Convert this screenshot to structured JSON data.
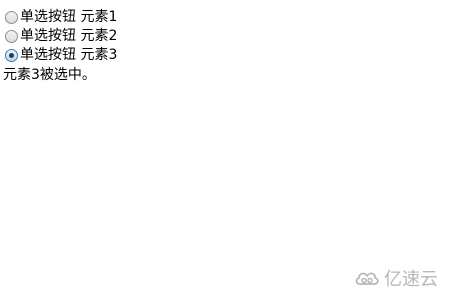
{
  "radios": [
    {
      "label": "单选按钮 元素1",
      "checked": false
    },
    {
      "label": "单选按钮 元素2",
      "checked": false
    },
    {
      "label": "单选按钮 元素3",
      "checked": true
    }
  ],
  "status_text": "元素3被选中。",
  "watermark": {
    "icon": "cloud-logo-icon",
    "text": "亿速云",
    "color": "#b8b8b8"
  }
}
